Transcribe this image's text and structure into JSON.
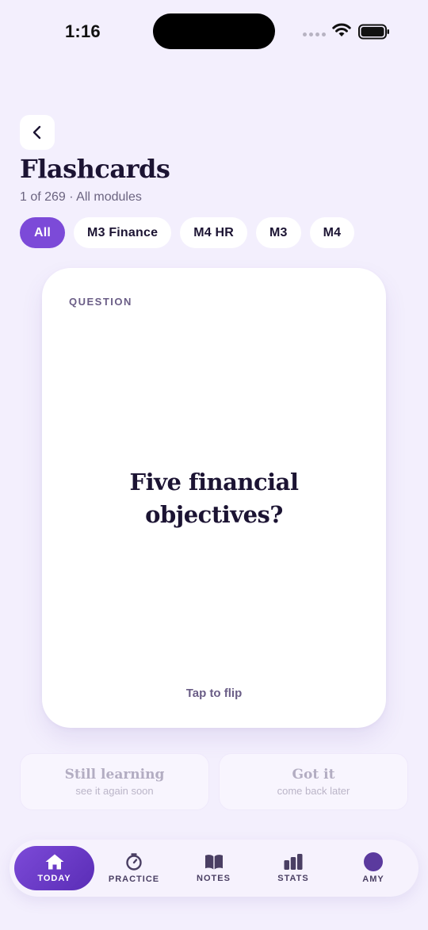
{
  "status_bar": {
    "time": "1:16"
  },
  "header": {
    "title": "Flashcards",
    "subtitle": "1 of 269 · All modules"
  },
  "filters": [
    "All",
    "M3 Finance",
    "M4 HR",
    "M3",
    "M4"
  ],
  "filters_active_index": 0,
  "card": {
    "kicker": "QUESTION",
    "question": "Five financial objectives?",
    "hint": "Tap to flip"
  },
  "actions": {
    "still_learning": {
      "title": "Still learning",
      "sub": "see it again soon"
    },
    "got_it": {
      "title": "Got it",
      "sub": "come back later"
    }
  },
  "tabs": [
    {
      "label": "TODAY",
      "icon": "home-icon"
    },
    {
      "label": "PRACTICE",
      "icon": "timer-icon"
    },
    {
      "label": "NOTES",
      "icon": "book-icon"
    },
    {
      "label": "STATS",
      "icon": "bar-chart-icon"
    },
    {
      "label": "AMY",
      "icon": "avatar-icon"
    }
  ],
  "colors": {
    "accent": "#7c4ad8",
    "background": "#f3effd"
  }
}
